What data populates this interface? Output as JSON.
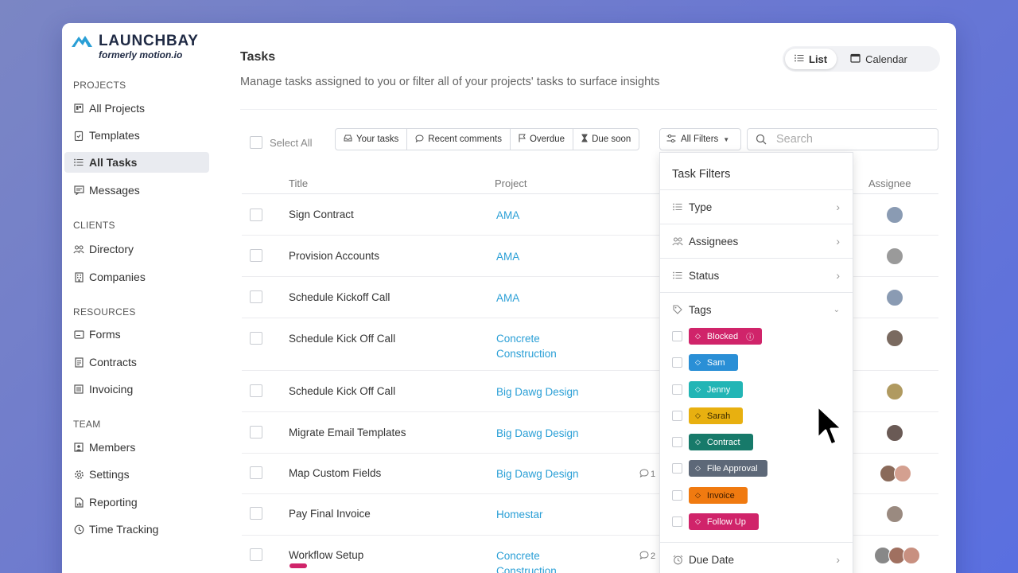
{
  "brand": {
    "name": "LAUNCHBAY",
    "subtitle": "formerly motion.io",
    "color": "#2a9fd6"
  },
  "sidebar": {
    "sections": [
      {
        "title": "PROJECTS",
        "items": [
          {
            "label": "All Projects",
            "icon": "projects-icon"
          },
          {
            "label": "Templates",
            "icon": "templates-icon"
          },
          {
            "label": "All Tasks",
            "icon": "list-icon",
            "active": true
          },
          {
            "label": "Messages",
            "icon": "messages-icon"
          }
        ]
      },
      {
        "title": "CLIENTS",
        "items": [
          {
            "label": "Directory",
            "icon": "people-icon"
          },
          {
            "label": "Companies",
            "icon": "building-icon"
          }
        ]
      },
      {
        "title": "RESOURCES",
        "items": [
          {
            "label": "Forms",
            "icon": "forms-icon"
          },
          {
            "label": "Contracts",
            "icon": "document-icon"
          },
          {
            "label": "Invoicing",
            "icon": "invoice-icon"
          }
        ]
      },
      {
        "title": "TEAM",
        "items": [
          {
            "label": "Members",
            "icon": "member-icon"
          },
          {
            "label": "Settings",
            "icon": "gear-icon"
          },
          {
            "label": "Reporting",
            "icon": "report-icon"
          },
          {
            "label": "Time Tracking",
            "icon": "clock-icon"
          }
        ]
      }
    ]
  },
  "header": {
    "title": "Tasks",
    "description": "Manage tasks assigned to you or filter all of your projects' tasks to surface insights",
    "views": [
      {
        "label": "List",
        "icon": "list-icon",
        "selected": true
      },
      {
        "label": "Calendar",
        "icon": "calendar-icon",
        "selected": false
      }
    ]
  },
  "toolbar": {
    "select_all": "Select All",
    "quick_filters": [
      {
        "label": "Your tasks",
        "icon": "inbox-icon"
      },
      {
        "label": "Recent comments",
        "icon": "comment-icon"
      },
      {
        "label": "Overdue",
        "icon": "flag-icon"
      },
      {
        "label": "Due soon",
        "icon": "hourglass-icon"
      }
    ],
    "all_filters": "All Filters",
    "search_placeholder": "Search"
  },
  "table": {
    "columns": {
      "title": "Title",
      "project": "Project",
      "assignee": "Assignee"
    },
    "rows": [
      {
        "title": "Sign Contract",
        "project": "AMA",
        "avatars": [
          "#8a9bb3"
        ]
      },
      {
        "title": "Provision Accounts",
        "project": "AMA",
        "avatars": [
          "#9a9a9a"
        ]
      },
      {
        "title": "Schedule Kickoff Call",
        "project": "AMA",
        "avatars": [
          "#8a9bb3"
        ]
      },
      {
        "title": "Schedule Kick Off Call",
        "project": "Concrete Construction",
        "avatars": [
          "#7a6a60"
        ]
      },
      {
        "title": "Schedule Kick Off Call",
        "project": "Big Dawg Design",
        "avatars": [
          "#b09a60"
        ]
      },
      {
        "title": "Migrate Email Templates",
        "project": "Big Dawg Design",
        "avatars": [
          "#6a5a55"
        ]
      },
      {
        "title": "Map Custom Fields",
        "project": "Big Dawg Design",
        "comments": "1",
        "avatars": [
          "#8a6a5a",
          "#d4a090"
        ]
      },
      {
        "title": "Pay Final Invoice",
        "project": "Homestar",
        "avatars": [
          "#9a8a80"
        ]
      },
      {
        "title": "Workflow Setup",
        "project": "Concrete Construction",
        "comments": "2",
        "avatars": [
          "#888888",
          "#a07060",
          "#c89080"
        ],
        "tag_color": "#d0246a"
      }
    ]
  },
  "filter_panel": {
    "title": "Task Filters",
    "filters": [
      {
        "label": "Type",
        "icon": "list-icon"
      },
      {
        "label": "Assignees",
        "icon": "people-icon"
      },
      {
        "label": "Status",
        "icon": "list-icon"
      }
    ],
    "tags_label": "Tags",
    "tags": [
      {
        "label": "Blocked",
        "color": "#d0246a",
        "info": true
      },
      {
        "label": "Sam",
        "color": "#2a8fd6"
      },
      {
        "label": "Jenny",
        "color": "#22b5b5"
      },
      {
        "label": "Sarah",
        "color": "#e8b010",
        "text_color": "#3a2a00"
      },
      {
        "label": "Contract",
        "color": "#177a6a"
      },
      {
        "label": "File Approval",
        "color": "#5d6878"
      },
      {
        "label": "Invoice",
        "color": "#f07a10",
        "text_color": "#3a1a00"
      },
      {
        "label": "Follow Up",
        "color": "#d0246a"
      }
    ],
    "due_date_label": "Due Date"
  }
}
